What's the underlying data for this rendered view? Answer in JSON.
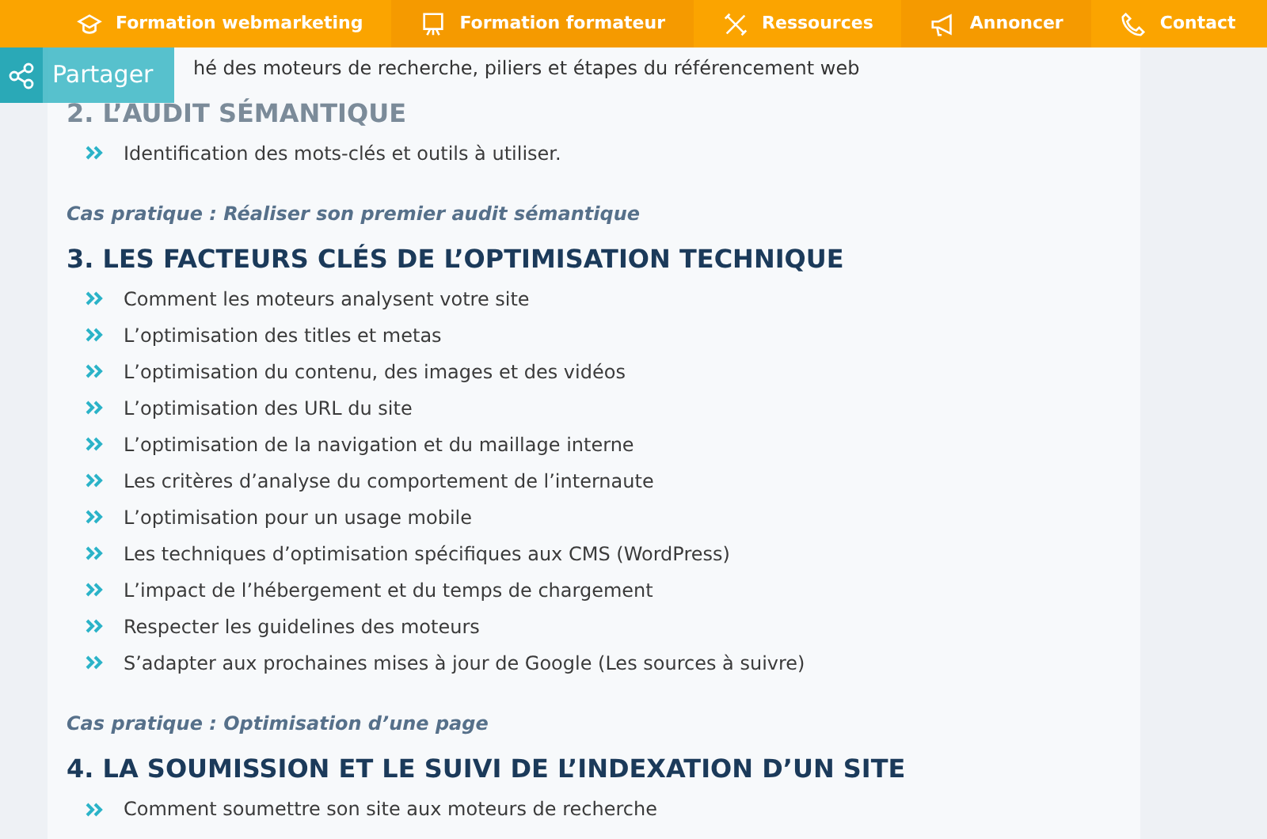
{
  "navbar": {
    "items": [
      {
        "label": "Formation webmarketing"
      },
      {
        "label": "Formation formateur"
      },
      {
        "label": "Ressources"
      },
      {
        "label": "Annoncer"
      },
      {
        "label": "Contact"
      }
    ]
  },
  "share_button": {
    "label": "Partager"
  },
  "content": [
    {
      "kind": "text",
      "text": "hé des moteurs de recherche, piliers et étapes du référencement web"
    },
    {
      "kind": "heading",
      "text": "2. L’AUDIT SÉMANTIQUE"
    },
    {
      "kind": "list",
      "items": [
        "Identification des mots-clés et outils à utiliser."
      ]
    },
    {
      "kind": "case",
      "text": "Cas pratique : Réaliser son premier audit sémantique"
    },
    {
      "kind": "heading",
      "text": "3. LES FACTEURS CLÉS DE L’OPTIMISATION TECHNIQUE"
    },
    {
      "kind": "list",
      "items": [
        "Comment les moteurs analysent votre site",
        "L’optimisation des titles et metas",
        "L’optimisation du contenu, des images et des vidéos",
        "L’optimisation des URL du site",
        "L’optimisation de la navigation et du maillage interne",
        "Les critères d’analyse du comportement de l’internaute",
        "L’optimisation pour un usage mobile",
        "Les techniques d’optimisation spécifiques aux CMS (WordPress)",
        "L’impact de l’hébergement et du temps de chargement",
        "Respecter les guidelines des moteurs",
        "S’adapter aux prochaines mises à jour de Google (Les sources à suivre)"
      ]
    },
    {
      "kind": "case",
      "text": "Cas pratique : Optimisation d’une page"
    },
    {
      "kind": "heading",
      "text": "4. LA SOUMISSION ET LE SUIVI DE L’INDEXATION D’UN SITE"
    },
    {
      "kind": "list",
      "items": [
        "Comment soumettre son site aux moteurs de recherche"
      ]
    }
  ]
}
